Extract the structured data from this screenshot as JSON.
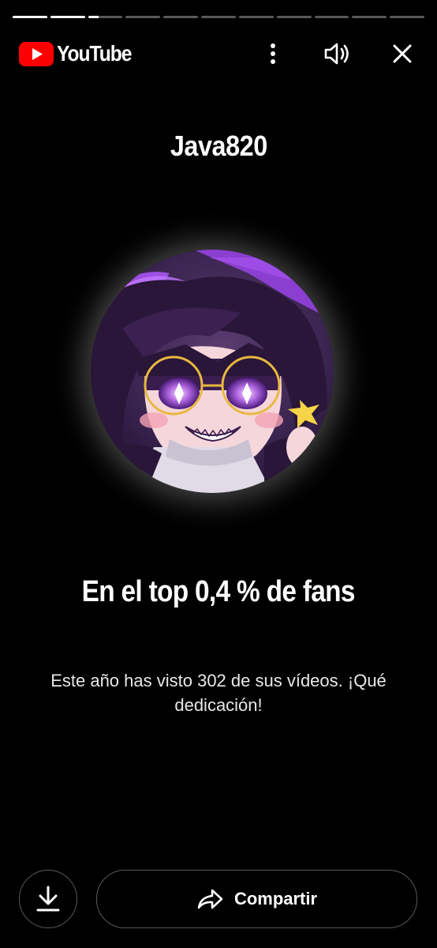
{
  "brand": {
    "logo_text": "YouTube",
    "logo_color": "#FF0000"
  },
  "story": {
    "segments": 11,
    "completed_segments": 2,
    "current_segment_progress": 0.3
  },
  "topbar": {
    "icons": [
      "more-vert-icon",
      "volume-icon",
      "close-icon"
    ]
  },
  "card": {
    "channel_name": "Java820",
    "headline": "En el top 0,4 % de fans",
    "subtext": "Este año has visto 302 de sus vídeos. ¡Qué dedicación!"
  },
  "actions": {
    "download_icon": "download-icon",
    "share_icon": "share-icon",
    "share_label": "Compartir"
  },
  "colors": {
    "background": "#000000",
    "text": "#FFFFFF",
    "button_border": "#5A5A5A"
  }
}
